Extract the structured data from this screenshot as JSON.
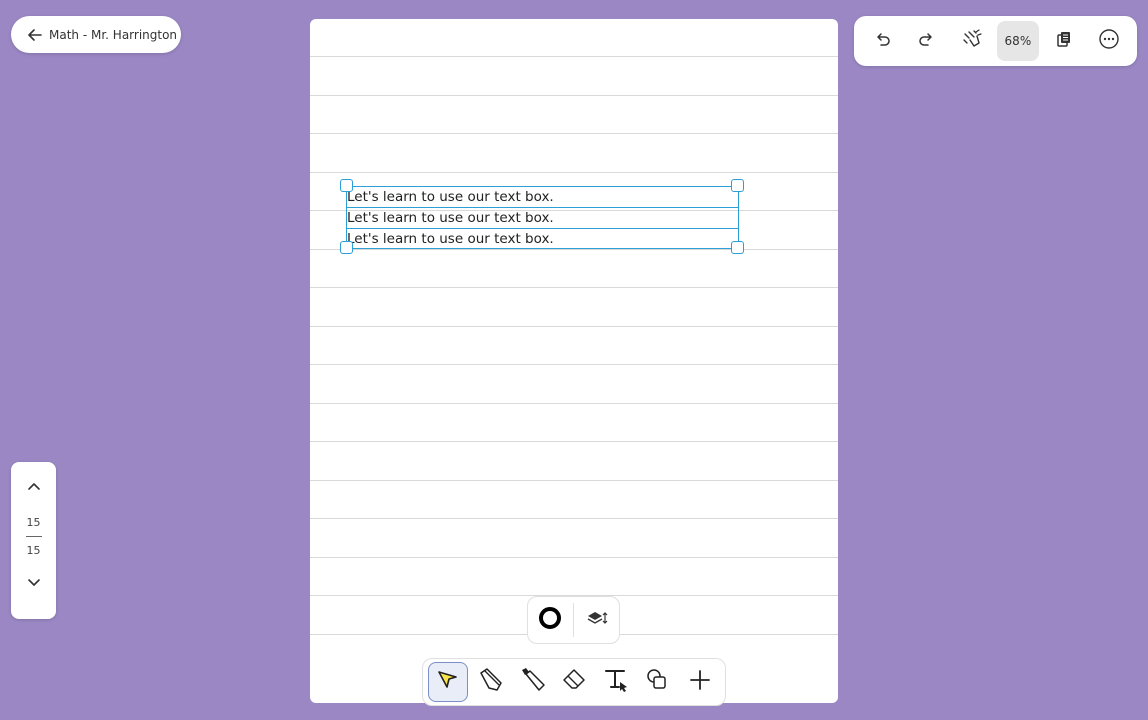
{
  "header": {
    "back_label": "Math - Mr. Harrington"
  },
  "toolbar": {
    "zoom": "68%",
    "icons": [
      "undo-icon",
      "redo-icon",
      "hand-gesture-icon",
      "zoom-level",
      "pages-icon",
      "more-icon"
    ]
  },
  "canvas": {
    "text_lines": [
      "Let's learn to use our text box.",
      "Let's learn to use our text box.",
      "Let's learn to use our text box."
    ]
  },
  "page_nav": {
    "current": "15",
    "total": "15"
  },
  "sub_toolbar": {
    "icons": [
      "color-ring-icon",
      "layers-icon"
    ]
  },
  "tools": [
    "select-tool",
    "pencil-tool",
    "marker-tool",
    "eraser-tool",
    "text-tool",
    "shapes-tool",
    "add-tool"
  ],
  "colors": {
    "background": "#9a87c4",
    "selection": "#2b9fd6",
    "active_tool_fill": "#f7e34b"
  }
}
